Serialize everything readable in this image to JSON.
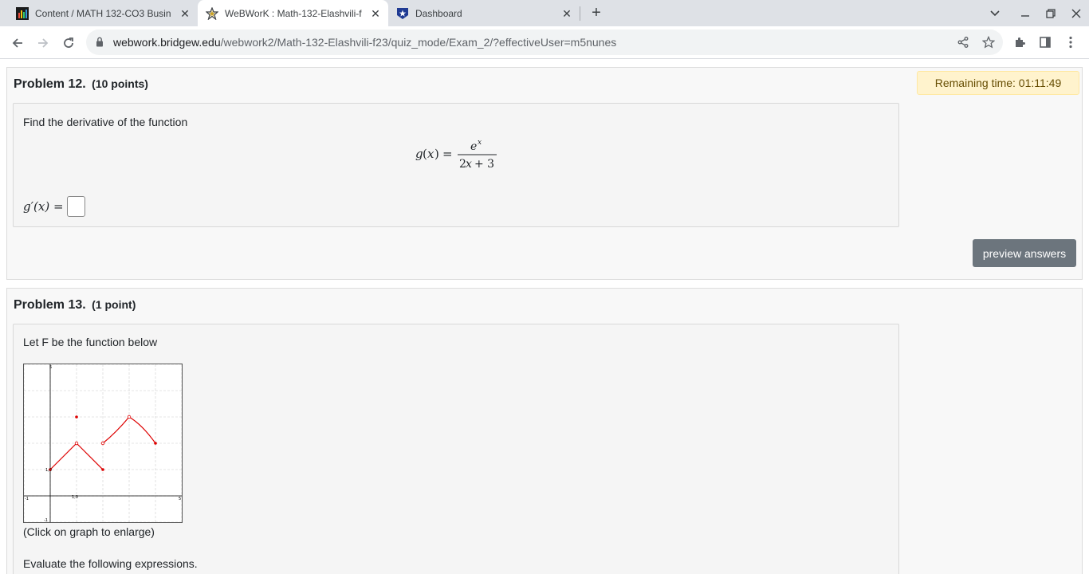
{
  "tabs": [
    {
      "title": "Content / MATH 132-CO3 Busin",
      "icon": "d2l-icon",
      "active": false
    },
    {
      "title": "WeBWorK : Math-132-Elashvili-f",
      "icon": "webwork-icon",
      "active": true
    },
    {
      "title": "Dashboard",
      "icon": "dashboard-icon",
      "active": false
    }
  ],
  "url": {
    "domain": "webwork.bridgew.edu",
    "path": "/webwork2/Math-132-Elashvili-f23/quiz_mode/Exam_2/?effectiveUser=m5nunes"
  },
  "problem12": {
    "title": "Problem 12.",
    "points": "(10 points)",
    "timer": "Remaining time: 01:11:49",
    "prompt": "Find the derivative of the function",
    "answer_label": "g′(x) =",
    "preview_label": "preview answers"
  },
  "problem13": {
    "title": "Problem 13.",
    "points": "(1 point)",
    "prompt": "Let F be the function below",
    "click_hint": "(Click on graph to enlarge)",
    "evaluate": "Evaluate the following expressions."
  },
  "graph": {
    "tick_labels": {
      "x_min": "-1",
      "x_max": "5",
      "y_max": "5",
      "y_min": "-1",
      "label_a": "1,0",
      "label_b": "1,0"
    },
    "x_range": [
      -1,
      5
    ],
    "y_range": [
      -1,
      5
    ],
    "curve_color": "#dd0000",
    "segments": [
      {
        "x": [
          0,
          1
        ],
        "y": [
          1,
          2
        ]
      },
      {
        "x": [
          1,
          2
        ],
        "y": [
          2,
          1
        ]
      },
      {
        "x": [
          2,
          2.5,
          3
        ],
        "y": [
          2,
          2.4,
          3
        ]
      },
      {
        "x": [
          3,
          3.5,
          4
        ],
        "y": [
          3,
          2.7,
          2
        ]
      }
    ],
    "filled_points": [
      {
        "x": 0,
        "y": 1
      },
      {
        "x": 1,
        "y": 3
      },
      {
        "x": 2,
        "y": 1
      },
      {
        "x": 4,
        "y": 2
      }
    ],
    "open_points": [
      {
        "x": 1,
        "y": 2
      },
      {
        "x": 2,
        "y": 2
      },
      {
        "x": 3,
        "y": 3
      }
    ]
  }
}
